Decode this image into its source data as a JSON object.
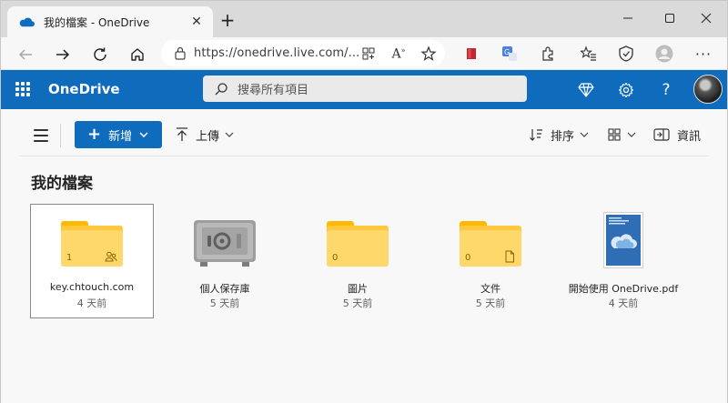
{
  "browser": {
    "tab_title": "我的檔案 - OneDrive",
    "url": "https://onedrive.live.com/..."
  },
  "header": {
    "brand": "OneDrive",
    "search_placeholder": "搜尋所有項目"
  },
  "commands": {
    "new_label": "新增",
    "upload_label": "上傳",
    "sort_label": "排序",
    "info_label": "資訊"
  },
  "page": {
    "title": "我的檔案"
  },
  "files": [
    {
      "name": "key.chtouch.com",
      "modified": "4 天前",
      "type": "shared-folder",
      "count": "1"
    },
    {
      "name": "個人保存庫",
      "modified": "5 天前",
      "type": "vault"
    },
    {
      "name": "圖片",
      "modified": "5 天前",
      "type": "folder",
      "count": "0"
    },
    {
      "name": "文件",
      "modified": "5 天前",
      "type": "document-folder",
      "count": "0"
    },
    {
      "name": "開始使用 OneDrive.pdf",
      "modified": "4 天前",
      "type": "pdf"
    }
  ],
  "colors": {
    "accent": "#0f6cbd",
    "folder": "#ffd86b"
  }
}
